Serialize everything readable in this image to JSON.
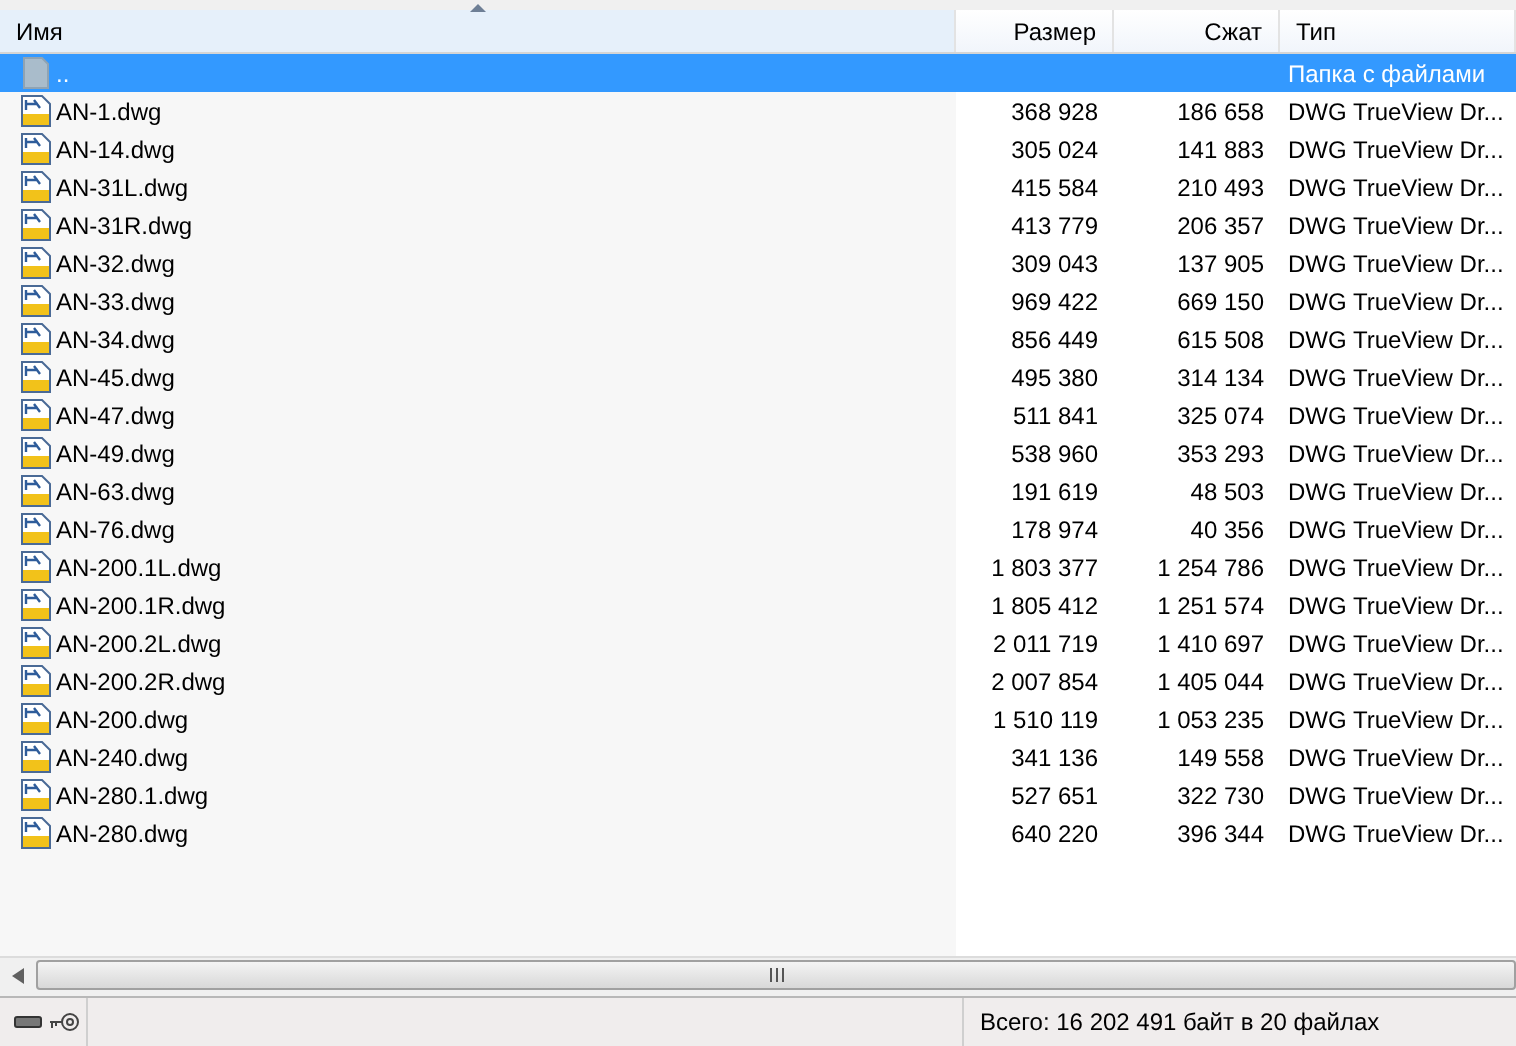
{
  "table": {
    "columns": [
      {
        "label": "Имя",
        "sorted": true
      },
      {
        "label": "Размер",
        "sorted": false
      },
      {
        "label": "Сжат",
        "sorted": false
      },
      {
        "label": "Тип",
        "sorted": false
      }
    ],
    "rows": [
      {
        "kind": "folder",
        "name": "..",
        "size": "",
        "packed": "",
        "type": "Папка с файлами",
        "selected": true
      },
      {
        "kind": "file",
        "name": "AN-1.dwg",
        "size": "368 928",
        "packed": "186 658",
        "type": "DWG TrueView Dr...",
        "selected": false
      },
      {
        "kind": "file",
        "name": "AN-14.dwg",
        "size": "305 024",
        "packed": "141 883",
        "type": "DWG TrueView Dr...",
        "selected": false
      },
      {
        "kind": "file",
        "name": "AN-31L.dwg",
        "size": "415 584",
        "packed": "210 493",
        "type": "DWG TrueView Dr...",
        "selected": false
      },
      {
        "kind": "file",
        "name": "AN-31R.dwg",
        "size": "413 779",
        "packed": "206 357",
        "type": "DWG TrueView Dr...",
        "selected": false
      },
      {
        "kind": "file",
        "name": "AN-32.dwg",
        "size": "309 043",
        "packed": "137 905",
        "type": "DWG TrueView Dr...",
        "selected": false
      },
      {
        "kind": "file",
        "name": "AN-33.dwg",
        "size": "969 422",
        "packed": "669 150",
        "type": "DWG TrueView Dr...",
        "selected": false
      },
      {
        "kind": "file",
        "name": "AN-34.dwg",
        "size": "856 449",
        "packed": "615 508",
        "type": "DWG TrueView Dr...",
        "selected": false
      },
      {
        "kind": "file",
        "name": "AN-45.dwg",
        "size": "495 380",
        "packed": "314 134",
        "type": "DWG TrueView Dr...",
        "selected": false
      },
      {
        "kind": "file",
        "name": "AN-47.dwg",
        "size": "511 841",
        "packed": "325 074",
        "type": "DWG TrueView Dr...",
        "selected": false
      },
      {
        "kind": "file",
        "name": "AN-49.dwg",
        "size": "538 960",
        "packed": "353 293",
        "type": "DWG TrueView Dr...",
        "selected": false
      },
      {
        "kind": "file",
        "name": "AN-63.dwg",
        "size": "191 619",
        "packed": "48 503",
        "type": "DWG TrueView Dr...",
        "selected": false
      },
      {
        "kind": "file",
        "name": "AN-76.dwg",
        "size": "178 974",
        "packed": "40 356",
        "type": "DWG TrueView Dr...",
        "selected": false
      },
      {
        "kind": "file",
        "name": "AN-200.1L.dwg",
        "size": "1 803 377",
        "packed": "1 254 786",
        "type": "DWG TrueView Dr...",
        "selected": false
      },
      {
        "kind": "file",
        "name": "AN-200.1R.dwg",
        "size": "1 805 412",
        "packed": "1 251 574",
        "type": "DWG TrueView Dr...",
        "selected": false
      },
      {
        "kind": "file",
        "name": "AN-200.2L.dwg",
        "size": "2 011 719",
        "packed": "1 410 697",
        "type": "DWG TrueView Dr...",
        "selected": false
      },
      {
        "kind": "file",
        "name": "AN-200.2R.dwg",
        "size": "2 007 854",
        "packed": "1 405 044",
        "type": "DWG TrueView Dr...",
        "selected": false
      },
      {
        "kind": "file",
        "name": "AN-200.dwg",
        "size": "1 510 119",
        "packed": "1 053 235",
        "type": "DWG TrueView Dr...",
        "selected": false
      },
      {
        "kind": "file",
        "name": "AN-240.dwg",
        "size": "341 136",
        "packed": "149 558",
        "type": "DWG TrueView Dr...",
        "selected": false
      },
      {
        "kind": "file",
        "name": "AN-280.1.dwg",
        "size": "527 651",
        "packed": "322 730",
        "type": "DWG TrueView Dr...",
        "selected": false
      },
      {
        "kind": "file",
        "name": "AN-280.dwg",
        "size": "640 220",
        "packed": "396 344",
        "type": "DWG TrueView Dr...",
        "selected": false
      }
    ]
  },
  "status_bar": {
    "summary": "Всего: 16 202 491 байт в 20 файлах"
  }
}
